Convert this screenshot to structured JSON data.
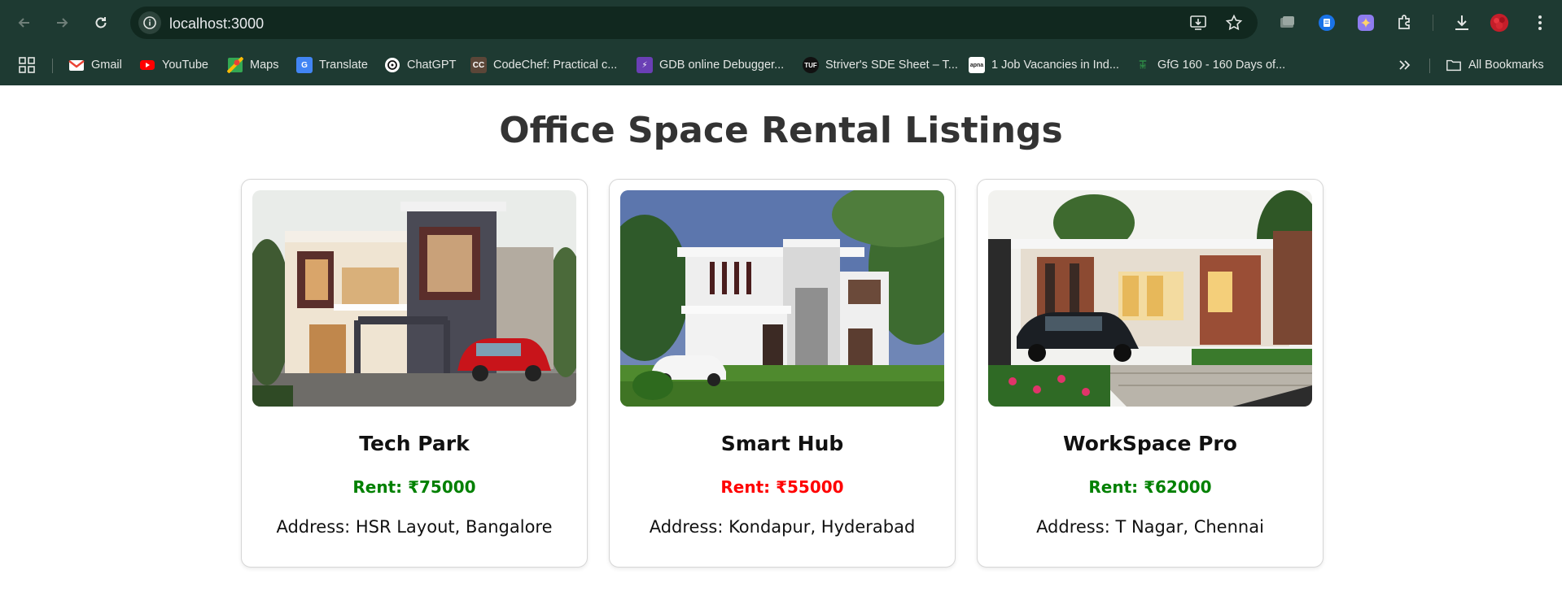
{
  "browser": {
    "url": "localhost:3000",
    "bookmarks": [
      {
        "label": "Gmail",
        "icon": "gmail-icon",
        "color": "#ea4335"
      },
      {
        "label": "YouTube",
        "icon": "youtube-icon",
        "color": "#ff0000"
      },
      {
        "label": "Maps",
        "icon": "maps-icon",
        "color": "#34a853"
      },
      {
        "label": "Translate",
        "icon": "translate-icon",
        "color": "#4285f4"
      },
      {
        "label": "ChatGPT",
        "icon": "chatgpt-icon",
        "color": "#ffffff"
      },
      {
        "label": "CodeChef: Practical c...",
        "icon": "codechef-icon",
        "color": "#5b4638"
      },
      {
        "label": "GDB online Debugger...",
        "icon": "gdb-icon",
        "color": "#6a3fb5"
      },
      {
        "label": "Striver's SDE Sheet – T...",
        "icon": "tuf-icon",
        "color": "#111111"
      },
      {
        "label": "1 Job Vacancies in Ind...",
        "icon": "apna-icon",
        "color": "#ffffff"
      },
      {
        "label": "GfG 160 - 160 Days of...",
        "icon": "gfg-icon",
        "color": "#2f8d46"
      }
    ],
    "all_bookmarks_label": "All Bookmarks"
  },
  "page": {
    "title": "Office Space Rental Listings"
  },
  "listings": [
    {
      "name": "Tech Park",
      "rent": "Rent: ₹75000",
      "rent_color": "#008000",
      "address": "Address: HSR Layout, Bangalore",
      "image": "modern-house-photo"
    },
    {
      "name": "Smart Hub",
      "rent": "Rent: ₹55000",
      "rent_color": "#ff0000",
      "address": "Address: Kondapur, Hyderabad",
      "image": "white-house-photo"
    },
    {
      "name": "WorkSpace Pro",
      "rent": "Rent: ₹62000",
      "rent_color": "#008000",
      "address": "Address: T Nagar, Chennai",
      "image": "house-with-car-photo"
    }
  ]
}
